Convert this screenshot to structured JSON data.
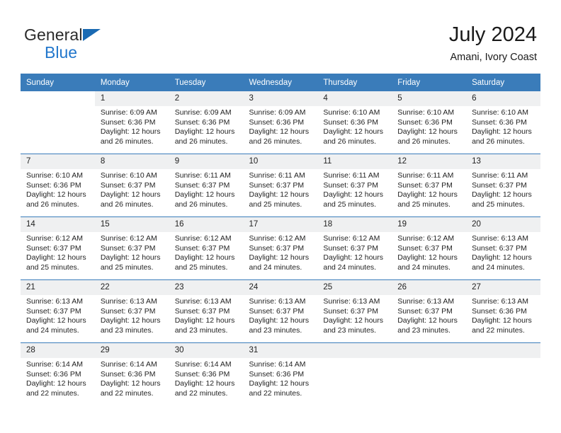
{
  "brand": {
    "line1": "General",
    "line2": "Blue",
    "triangle_color": "#1a6ab3",
    "text_color": "#2b2b2b",
    "blue_text_color": "#2277cc"
  },
  "header": {
    "title": "July 2024",
    "subtitle": "Amani, Ivory Coast"
  },
  "theme": {
    "header_bar": "#3a7cba",
    "daynum_bg": "#eff0f1",
    "row_rule": "#3a7cba",
    "text": "#232323"
  },
  "weekdays": [
    "Sunday",
    "Monday",
    "Tuesday",
    "Wednesday",
    "Thursday",
    "Friday",
    "Saturday"
  ],
  "weeks": [
    [
      {
        "day": "",
        "sunrise": "",
        "sunset": "",
        "daylight1": "",
        "daylight2": "",
        "blank": true,
        "empty": true
      },
      {
        "day": "1",
        "sunrise": "Sunrise: 6:09 AM",
        "sunset": "Sunset: 6:36 PM",
        "daylight1": "Daylight: 12 hours",
        "daylight2": "and 26 minutes."
      },
      {
        "day": "2",
        "sunrise": "Sunrise: 6:09 AM",
        "sunset": "Sunset: 6:36 PM",
        "daylight1": "Daylight: 12 hours",
        "daylight2": "and 26 minutes."
      },
      {
        "day": "3",
        "sunrise": "Sunrise: 6:09 AM",
        "sunset": "Sunset: 6:36 PM",
        "daylight1": "Daylight: 12 hours",
        "daylight2": "and 26 minutes."
      },
      {
        "day": "4",
        "sunrise": "Sunrise: 6:10 AM",
        "sunset": "Sunset: 6:36 PM",
        "daylight1": "Daylight: 12 hours",
        "daylight2": "and 26 minutes."
      },
      {
        "day": "5",
        "sunrise": "Sunrise: 6:10 AM",
        "sunset": "Sunset: 6:36 PM",
        "daylight1": "Daylight: 12 hours",
        "daylight2": "and 26 minutes."
      },
      {
        "day": "6",
        "sunrise": "Sunrise: 6:10 AM",
        "sunset": "Sunset: 6:36 PM",
        "daylight1": "Daylight: 12 hours",
        "daylight2": "and 26 minutes."
      }
    ],
    [
      {
        "day": "7",
        "sunrise": "Sunrise: 6:10 AM",
        "sunset": "Sunset: 6:36 PM",
        "daylight1": "Daylight: 12 hours",
        "daylight2": "and 26 minutes."
      },
      {
        "day": "8",
        "sunrise": "Sunrise: 6:10 AM",
        "sunset": "Sunset: 6:37 PM",
        "daylight1": "Daylight: 12 hours",
        "daylight2": "and 26 minutes."
      },
      {
        "day": "9",
        "sunrise": "Sunrise: 6:11 AM",
        "sunset": "Sunset: 6:37 PM",
        "daylight1": "Daylight: 12 hours",
        "daylight2": "and 26 minutes."
      },
      {
        "day": "10",
        "sunrise": "Sunrise: 6:11 AM",
        "sunset": "Sunset: 6:37 PM",
        "daylight1": "Daylight: 12 hours",
        "daylight2": "and 25 minutes."
      },
      {
        "day": "11",
        "sunrise": "Sunrise: 6:11 AM",
        "sunset": "Sunset: 6:37 PM",
        "daylight1": "Daylight: 12 hours",
        "daylight2": "and 25 minutes."
      },
      {
        "day": "12",
        "sunrise": "Sunrise: 6:11 AM",
        "sunset": "Sunset: 6:37 PM",
        "daylight1": "Daylight: 12 hours",
        "daylight2": "and 25 minutes."
      },
      {
        "day": "13",
        "sunrise": "Sunrise: 6:11 AM",
        "sunset": "Sunset: 6:37 PM",
        "daylight1": "Daylight: 12 hours",
        "daylight2": "and 25 minutes."
      }
    ],
    [
      {
        "day": "14",
        "sunrise": "Sunrise: 6:12 AM",
        "sunset": "Sunset: 6:37 PM",
        "daylight1": "Daylight: 12 hours",
        "daylight2": "and 25 minutes."
      },
      {
        "day": "15",
        "sunrise": "Sunrise: 6:12 AM",
        "sunset": "Sunset: 6:37 PM",
        "daylight1": "Daylight: 12 hours",
        "daylight2": "and 25 minutes."
      },
      {
        "day": "16",
        "sunrise": "Sunrise: 6:12 AM",
        "sunset": "Sunset: 6:37 PM",
        "daylight1": "Daylight: 12 hours",
        "daylight2": "and 25 minutes."
      },
      {
        "day": "17",
        "sunrise": "Sunrise: 6:12 AM",
        "sunset": "Sunset: 6:37 PM",
        "daylight1": "Daylight: 12 hours",
        "daylight2": "and 24 minutes."
      },
      {
        "day": "18",
        "sunrise": "Sunrise: 6:12 AM",
        "sunset": "Sunset: 6:37 PM",
        "daylight1": "Daylight: 12 hours",
        "daylight2": "and 24 minutes."
      },
      {
        "day": "19",
        "sunrise": "Sunrise: 6:12 AM",
        "sunset": "Sunset: 6:37 PM",
        "daylight1": "Daylight: 12 hours",
        "daylight2": "and 24 minutes."
      },
      {
        "day": "20",
        "sunrise": "Sunrise: 6:13 AM",
        "sunset": "Sunset: 6:37 PM",
        "daylight1": "Daylight: 12 hours",
        "daylight2": "and 24 minutes."
      }
    ],
    [
      {
        "day": "21",
        "sunrise": "Sunrise: 6:13 AM",
        "sunset": "Sunset: 6:37 PM",
        "daylight1": "Daylight: 12 hours",
        "daylight2": "and 24 minutes."
      },
      {
        "day": "22",
        "sunrise": "Sunrise: 6:13 AM",
        "sunset": "Sunset: 6:37 PM",
        "daylight1": "Daylight: 12 hours",
        "daylight2": "and 23 minutes."
      },
      {
        "day": "23",
        "sunrise": "Sunrise: 6:13 AM",
        "sunset": "Sunset: 6:37 PM",
        "daylight1": "Daylight: 12 hours",
        "daylight2": "and 23 minutes."
      },
      {
        "day": "24",
        "sunrise": "Sunrise: 6:13 AM",
        "sunset": "Sunset: 6:37 PM",
        "daylight1": "Daylight: 12 hours",
        "daylight2": "and 23 minutes."
      },
      {
        "day": "25",
        "sunrise": "Sunrise: 6:13 AM",
        "sunset": "Sunset: 6:37 PM",
        "daylight1": "Daylight: 12 hours",
        "daylight2": "and 23 minutes."
      },
      {
        "day": "26",
        "sunrise": "Sunrise: 6:13 AM",
        "sunset": "Sunset: 6:37 PM",
        "daylight1": "Daylight: 12 hours",
        "daylight2": "and 23 minutes."
      },
      {
        "day": "27",
        "sunrise": "Sunrise: 6:13 AM",
        "sunset": "Sunset: 6:36 PM",
        "daylight1": "Daylight: 12 hours",
        "daylight2": "and 22 minutes."
      }
    ],
    [
      {
        "day": "28",
        "sunrise": "Sunrise: 6:14 AM",
        "sunset": "Sunset: 6:36 PM",
        "daylight1": "Daylight: 12 hours",
        "daylight2": "and 22 minutes."
      },
      {
        "day": "29",
        "sunrise": "Sunrise: 6:14 AM",
        "sunset": "Sunset: 6:36 PM",
        "daylight1": "Daylight: 12 hours",
        "daylight2": "and 22 minutes."
      },
      {
        "day": "30",
        "sunrise": "Sunrise: 6:14 AM",
        "sunset": "Sunset: 6:36 PM",
        "daylight1": "Daylight: 12 hours",
        "daylight2": "and 22 minutes."
      },
      {
        "day": "31",
        "sunrise": "Sunrise: 6:14 AM",
        "sunset": "Sunset: 6:36 PM",
        "daylight1": "Daylight: 12 hours",
        "daylight2": "and 22 minutes."
      },
      {
        "day": "",
        "sunrise": "",
        "sunset": "",
        "daylight1": "",
        "daylight2": "",
        "empty": true
      },
      {
        "day": "",
        "sunrise": "",
        "sunset": "",
        "daylight1": "",
        "daylight2": "",
        "empty": true
      },
      {
        "day": "",
        "sunrise": "",
        "sunset": "",
        "daylight1": "",
        "daylight2": "",
        "empty": true
      }
    ]
  ]
}
